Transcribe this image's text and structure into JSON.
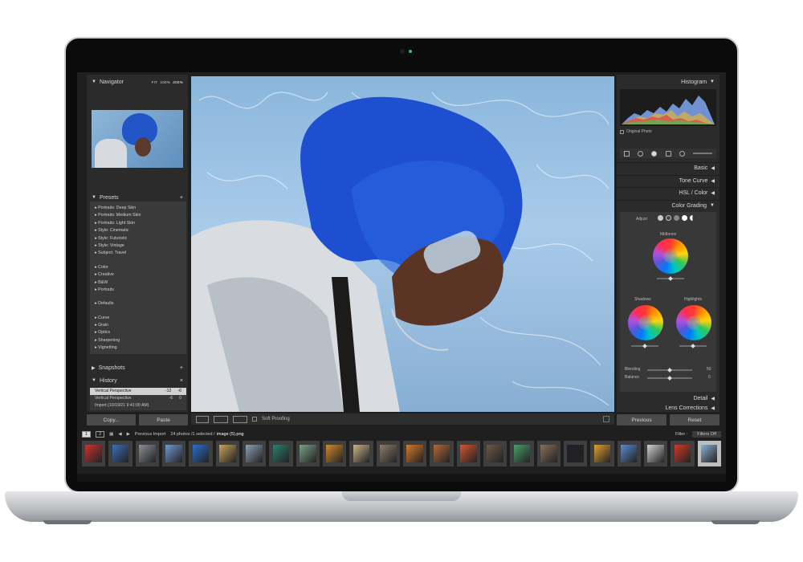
{
  "navigator": {
    "title": "Navigator",
    "zoom_options": [
      "FIT",
      "100%",
      "200%"
    ]
  },
  "presets": {
    "title": "Presets",
    "groups": [
      [
        "Portraits: Deep Skin",
        "Portraits: Medium Skin",
        "Portraits: Light Skin",
        "Style: Cinematic",
        "Style: Futuristic",
        "Style: Vintage",
        "Subject: Travel"
      ],
      [
        "Color",
        "Creative",
        "B&W",
        "Portraits"
      ],
      [
        "Defaults"
      ],
      [
        "Curve",
        "Grain",
        "Optics",
        "Sharpening",
        "Vignetting"
      ]
    ]
  },
  "snapshots": {
    "title": "Snapshots"
  },
  "history": {
    "title": "History",
    "rows": [
      {
        "label": "Vertical Perspective",
        "a": "-12",
        "b": "-6",
        "selected": true
      },
      {
        "label": "Vertical Perspective",
        "a": "-6",
        "b": "0",
        "selected": false
      },
      {
        "label": "Import (10/19/21 9:41:00 AM)",
        "a": "",
        "b": "",
        "selected": false
      }
    ]
  },
  "left_buttons": {
    "copy": "Copy...",
    "paste": "Paste"
  },
  "toolbar": {
    "soft_proofing": "Soft Proofing"
  },
  "right_panel": {
    "histogram": "Histogram",
    "original_photo": "Original Photo",
    "sections": [
      "Basic",
      "Tone Curve",
      "HSL / Color",
      "Color Grading"
    ],
    "color_grading": {
      "adjust": "Adjust",
      "midtones": "Midtones",
      "shadows": "Shadows",
      "highlights": "Highlights",
      "blending_label": "Blending",
      "blending_value": "50",
      "balance_label": "Balance",
      "balance_value": "0"
    },
    "bottom_sections": [
      "Detail",
      "Lens Corrections"
    ]
  },
  "right_buttons": {
    "previous": "Previous",
    "reset": "Reset"
  },
  "filmstrip": {
    "pages": [
      "1",
      "2"
    ],
    "source": "Previous Import",
    "info": "24 photos /1 selected /",
    "file": "image (5).png",
    "filter_label": "Filter :",
    "filter_value": "Filters Off",
    "thumb_colors": [
      "#c8332f",
      "#3d6fb5",
      "#8a8f96",
      "#6f9ad0",
      "#2b6fcf",
      "#c9a35a",
      "#8ea0b5",
      "#2d7f6f",
      "#7aa08a",
      "#d08a2d",
      "#c9b38a",
      "#8c7d6a",
      "#d67b2b",
      "#b06a3a",
      "#d2562e",
      "#6a5a4a",
      "#4aa06a",
      "#8a6f5a",
      "#1f1f2a",
      "#e0a030",
      "#5a8ad0",
      "#d0d0d0",
      "#d03a2a",
      "#8ab0d0"
    ]
  }
}
